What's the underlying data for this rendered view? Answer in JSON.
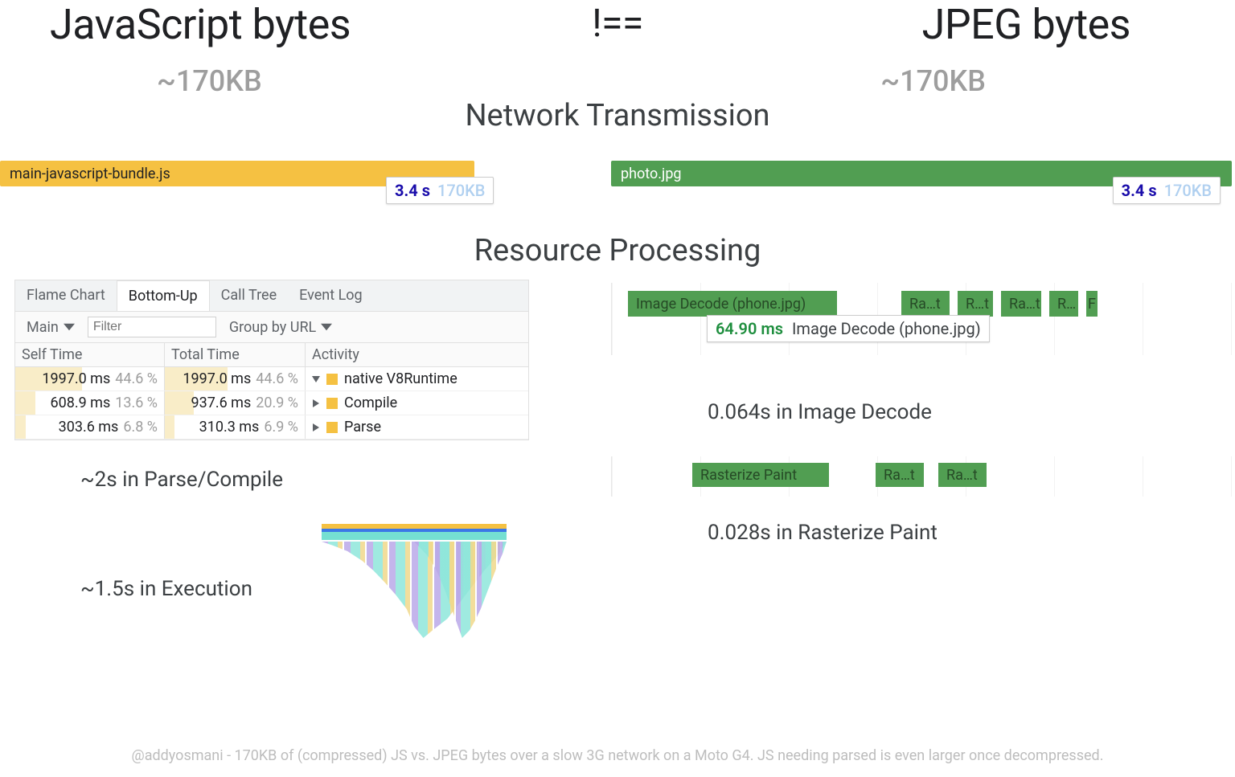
{
  "headline": {
    "left": "JavaScript bytes",
    "mid": "!==",
    "right": "JPEG bytes",
    "size_left": "~170KB",
    "size_right": "~170KB"
  },
  "sections": {
    "network": "Network Transmission",
    "processing": "Resource Processing"
  },
  "network": {
    "js_file": "main-javascript-bundle.js",
    "img_file": "photo.jpg",
    "js_badge_time": "3.4 s",
    "js_badge_size": "170KB",
    "img_badge_time": "3.4 s",
    "img_badge_size": "170KB"
  },
  "devtools": {
    "tabs": [
      "Flame Chart",
      "Bottom-Up",
      "Call Tree",
      "Event Log"
    ],
    "active_tab": 1,
    "thread": "Main",
    "filter_placeholder": "Filter",
    "group": "Group by URL",
    "cols": [
      "Self Time",
      "Total Time",
      "Activity"
    ],
    "rows": [
      {
        "self_ms": "1997.0 ms",
        "self_pct": "44.6 %",
        "self_bar": 44.6,
        "total_ms": "1997.0 ms",
        "total_pct": "44.6 %",
        "total_bar": 44.6,
        "activity": "native V8Runtime",
        "expanded": true
      },
      {
        "self_ms": "608.9 ms",
        "self_pct": "13.6 %",
        "self_bar": 13.6,
        "total_ms": "937.6 ms",
        "total_pct": "20.9 %",
        "total_bar": 20.9,
        "activity": "Compile",
        "expanded": false
      },
      {
        "self_ms": "303.6 ms",
        "self_pct": "6.8 %",
        "self_bar": 6.8,
        "total_ms": "310.3 ms",
        "total_pct": "6.9 %",
        "total_bar": 6.9,
        "activity": "Parse",
        "expanded": false
      }
    ]
  },
  "js_metrics": {
    "parse_compile": "~2s in Parse/Compile",
    "execution": "~1.5s in Execution"
  },
  "img_timeline": {
    "decode_label": "Image Decode (phone.jpg)",
    "raster_labels": [
      "Ra…t",
      "R…t",
      "Ra…t",
      "R…",
      "F"
    ],
    "tooltip_ms": "64.90 ms",
    "tooltip_label": "Image Decode (phone.jpg)",
    "raster2": [
      "Rasterize Paint",
      "Ra…t",
      "Ra…t"
    ]
  },
  "img_metrics": {
    "decode": "0.064s in Image Decode",
    "raster": "0.028s in Rasterize Paint"
  },
  "footer": "@addyosmani - 170KB of (compressed) JS vs. JPEG bytes over a slow 3G network on a Moto G4. JS needing parsed is even larger once decompressed."
}
